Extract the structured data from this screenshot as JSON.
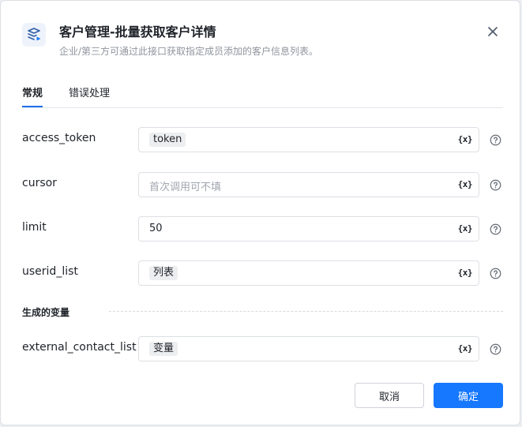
{
  "dialog": {
    "title": "客户管理-批量获取客户详情",
    "subtitle": "企业/第三方可通过此接口获取指定成员添加的客户信息列表。",
    "icon": "layers-play-icon"
  },
  "tabs": [
    {
      "label": "常规",
      "active": true
    },
    {
      "label": "错误处理",
      "active": false
    }
  ],
  "fields": {
    "access_token": {
      "label": "access_token",
      "tag": "token"
    },
    "cursor": {
      "label": "cursor",
      "placeholder": "首次调用可不填"
    },
    "limit": {
      "label": "limit",
      "value": "50"
    },
    "userid_list": {
      "label": "userid_list",
      "tag": "列表"
    },
    "external_contact_list": {
      "label": "external_contact_list",
      "tag": "变量"
    }
  },
  "variable_button_label": "{x}",
  "output_section": {
    "title": "生成的变量"
  },
  "footer": {
    "cancel_label": "取消",
    "confirm_label": "确定"
  },
  "colors": {
    "primary": "#1677ff",
    "tab_indicator": "#1f6feb",
    "text": "#1f2329",
    "muted": "#8f959e"
  }
}
